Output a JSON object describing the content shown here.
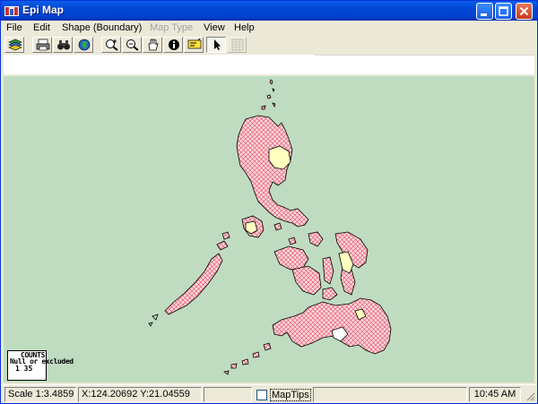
{
  "window": {
    "title": "Epi Map",
    "accent": "#0046d5",
    "close_color": "#c73a1a"
  },
  "menu": {
    "file": "File",
    "edit": "Edit",
    "shape": "Shape (Boundary)",
    "map_type": "Map Type",
    "view": "View",
    "help": "Help"
  },
  "toolbar": {
    "icons": [
      "layers-icon",
      "print-icon",
      "find-icon",
      "globe-icon",
      "zoom-in-icon",
      "zoom-out-icon",
      "pan-hand-icon",
      "info-icon",
      "label-icon",
      "pointer-icon",
      "grid-icon"
    ]
  },
  "map": {
    "background": "#c0dcc0",
    "hatch_color": "#e06070",
    "fill_color": "#ffd8e0",
    "highlight_color": "#ffffc0"
  },
  "legend": {
    "title": "COUNTS",
    "excluded": "Null or excluded",
    "range": "1 35"
  },
  "status": {
    "scale": "Scale 1:3.4859",
    "coords": "X:124.20692 Y:21.04559",
    "maptips_label": "MapTips",
    "maptips_checked": false,
    "time": "10:45 AM"
  }
}
